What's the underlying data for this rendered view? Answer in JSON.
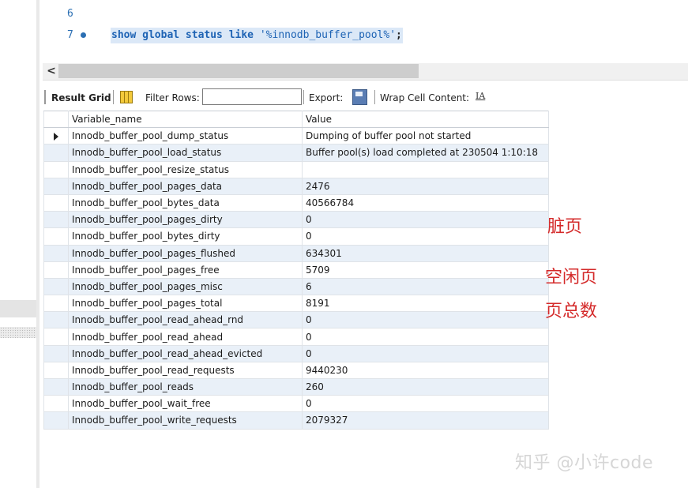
{
  "editor": {
    "lines": [
      {
        "number": "6",
        "code": ""
      },
      {
        "number": "7",
        "code_keywords": "show global status like",
        "code_string": "'%innodb_buffer_pool%'",
        "code_end": ";"
      }
    ]
  },
  "hscroll": {
    "arrow": "<"
  },
  "toolbar": {
    "result_grid": "Result Grid",
    "filter_rows": "Filter Rows:",
    "filter_value": "",
    "export": "Export:",
    "wrap_cell": "Wrap Cell Content:",
    "wrap_icon": "IA"
  },
  "grid": {
    "columns": [
      "Variable_name",
      "Value"
    ],
    "rows": [
      [
        "Innodb_buffer_pool_dump_status",
        "Dumping of buffer pool not started"
      ],
      [
        "Innodb_buffer_pool_load_status",
        "Buffer pool(s) load completed at 230504  1:10:18"
      ],
      [
        "Innodb_buffer_pool_resize_status",
        ""
      ],
      [
        "Innodb_buffer_pool_pages_data",
        "2476"
      ],
      [
        "Innodb_buffer_pool_bytes_data",
        "40566784"
      ],
      [
        "Innodb_buffer_pool_pages_dirty",
        "0"
      ],
      [
        "Innodb_buffer_pool_bytes_dirty",
        "0"
      ],
      [
        "Innodb_buffer_pool_pages_flushed",
        "634301"
      ],
      [
        "Innodb_buffer_pool_pages_free",
        "5709"
      ],
      [
        "Innodb_buffer_pool_pages_misc",
        "6"
      ],
      [
        "Innodb_buffer_pool_pages_total",
        "8191"
      ],
      [
        "Innodb_buffer_pool_read_ahead_rnd",
        "0"
      ],
      [
        "Innodb_buffer_pool_read_ahead",
        "0"
      ],
      [
        "Innodb_buffer_pool_read_ahead_evicted",
        "0"
      ],
      [
        "Innodb_buffer_pool_read_requests",
        "9440230"
      ],
      [
        "Innodb_buffer_pool_reads",
        "260"
      ],
      [
        "Innodb_buffer_pool_wait_free",
        "0"
      ],
      [
        "Innodb_buffer_pool_write_requests",
        "2079327"
      ]
    ]
  },
  "annotations": {
    "dirty_pages": "脏页",
    "free_pages": "空闲页",
    "total_pages": "页总数"
  },
  "watermark": "知乎 @小许code",
  "colors": {
    "annotation": "#d42a2a",
    "selection": "#dbe8f7",
    "keyword": "#1e63b4",
    "alt_row": "#e9f0f8"
  }
}
